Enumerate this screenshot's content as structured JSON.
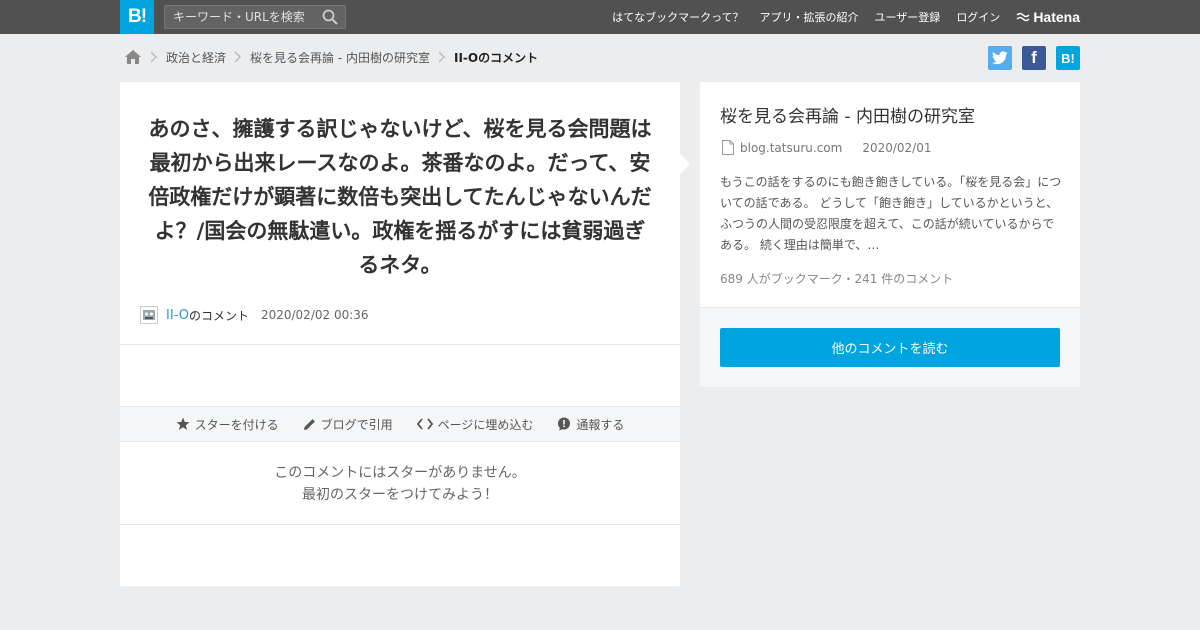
{
  "header": {
    "logo_text": "B!",
    "search_placeholder": "キーワード・URLを検索",
    "nav": [
      "はてなブックマークって？",
      "アプリ・拡張の紹介",
      "ユーザー登録",
      "ログイン"
    ],
    "brand": "Hatena"
  },
  "breadcrumb": {
    "home_icon": "home-icon",
    "items": [
      "政治と経済",
      "桜を見る会再論 - 内田樹の研究室"
    ],
    "current": "II-Oのコメント"
  },
  "share": {
    "twitter": "twitter-icon",
    "facebook_glyph": "f",
    "hatebu_glyph": "B!"
  },
  "comment": {
    "text": "あのさ、擁護する訳じゃないけど、桜を見る会問題は最初から出来レースなのよ。茶番なのよ。だって、安倍政権だけが顕著に数倍も突出してたんじゃないんだよ？/国会の無駄遣い。政権を揺るがすには貧弱過ぎるネタ。",
    "user": "II-O",
    "user_suffix": "のコメント",
    "date": "2020/02/02 00:36"
  },
  "actions": [
    "スターを付ける",
    "ブログで引用",
    "ページに埋め込む",
    "通報する"
  ],
  "no_star": {
    "line1": "このコメントにはスターがありません。",
    "line2": "最初のスターをつけてみよう！"
  },
  "entry": {
    "title": "桜を見る会再論 - 内田樹の研究室",
    "domain": "blog.tatsuru.com",
    "date": "2020/02/01",
    "description": "もうこの話をするのにも飽き飽きしている。「桜を見る会」についての話である。 どうして「飽き飽き」しているかというと、ふつうの人間の受忍限度を超えて、この話が続いているからである。 続く理由は簡単で、…",
    "stats": "689 人がブックマーク・241 件のコメント",
    "button": "他のコメントを読む"
  },
  "colors": {
    "accent": "#00a4de",
    "header_bg": "#515151",
    "page_bg": "#ebedef",
    "user_link": "#2a9bc4"
  }
}
